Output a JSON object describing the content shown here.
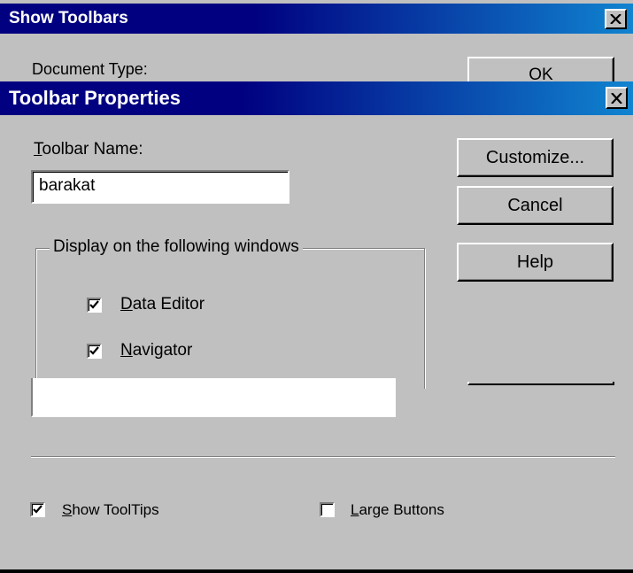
{
  "show_toolbars_dialog": {
    "title": "Show Toolbars",
    "document_type_label": "Document Type:",
    "ok_label": "OK",
    "close_glyph": "close-icon"
  },
  "toolbar_properties_dialog": {
    "title": "Toolbar Properties",
    "close_glyph": "close-icon",
    "toolbar_name": {
      "label_accel": "T",
      "label_rest": "oolbar Name:",
      "value": "barakat"
    },
    "buttons": {
      "customize": "Customize...",
      "cancel": "Cancel",
      "help": "Help"
    },
    "group": {
      "legend": "Display on the following windows",
      "items": [
        {
          "accel": "D",
          "rest": "ata Editor",
          "checked": true
        },
        {
          "accel": "N",
          "rest": "avigator",
          "checked": true
        }
      ]
    }
  },
  "bottom_options": {
    "show_tooltips": {
      "accel": "S",
      "rest": "how ToolTips",
      "checked": true
    },
    "large_buttons": {
      "accel": "L",
      "rest": "arge Buttons",
      "checked": false
    }
  },
  "colors": {
    "titlebar_start": "#000080",
    "titlebar_end": "#1084d0",
    "face": "#c0c0c0"
  }
}
